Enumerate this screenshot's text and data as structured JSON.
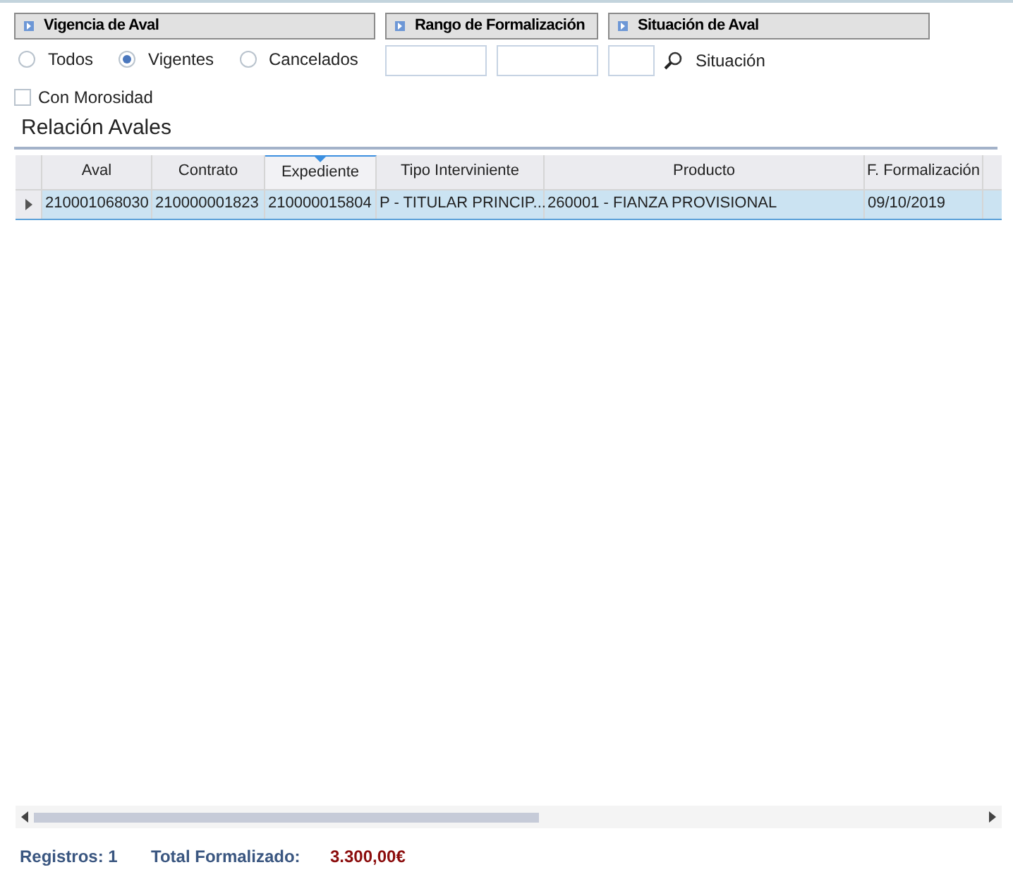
{
  "panels": [
    {
      "title": "Vigencia de Aval"
    },
    {
      "title": "Rango de Formalización"
    },
    {
      "title": "Situación de Aval"
    }
  ],
  "vigencia_options": [
    {
      "label": "Todos",
      "selected": false
    },
    {
      "label": "Vigentes",
      "selected": true
    },
    {
      "label": "Cancelados",
      "selected": false
    }
  ],
  "situacion_label": "Situación",
  "con_morosidad": {
    "label": "Con Morosidad",
    "checked": false
  },
  "section_title": "Relación Avales",
  "table": {
    "columns": [
      {
        "label": "Aval",
        "sorted": false
      },
      {
        "label": "Contrato",
        "sorted": false
      },
      {
        "label": "Expediente",
        "sorted": true
      },
      {
        "label": "Tipo Interviniente",
        "sorted": false
      },
      {
        "label": "Producto",
        "sorted": false
      },
      {
        "label": "F. Formalización",
        "sorted": false
      }
    ],
    "rows": [
      {
        "selected": true,
        "cells": [
          "210001068030",
          "210000001823",
          "210000015804",
          "P - TITULAR PRINCIP...",
          "260001 - FIANZA PROVISIONAL",
          "09/10/2019"
        ]
      }
    ]
  },
  "footer": {
    "registros": "Registros: 1",
    "total_label": "Total Formalizado:",
    "total_value": "3.300,00€"
  }
}
